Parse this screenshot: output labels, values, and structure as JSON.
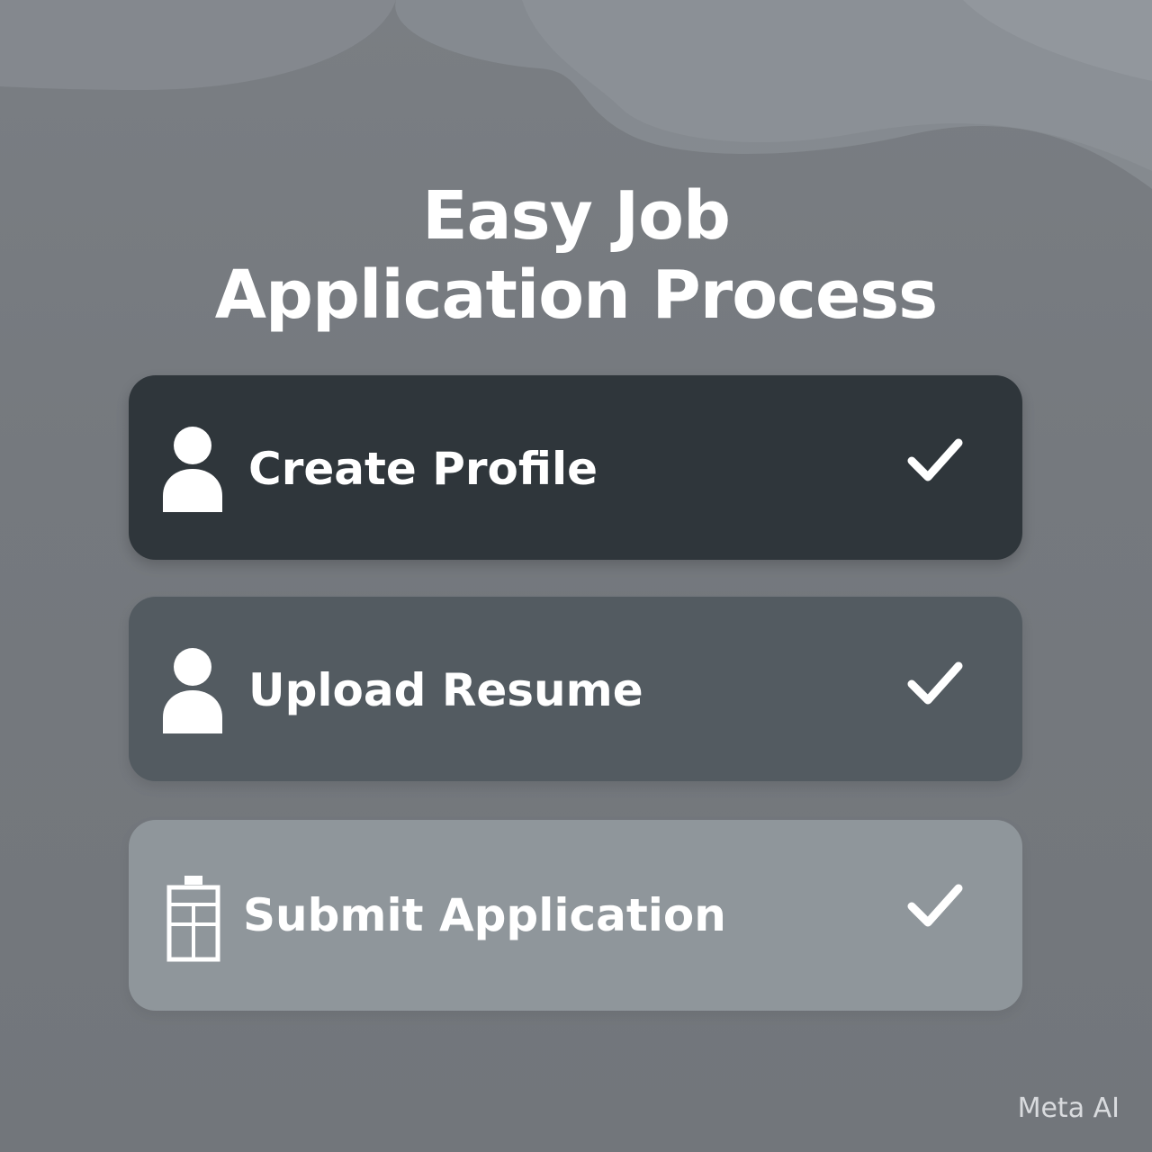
{
  "page": {
    "title_line1": "Easy Job",
    "title_line2": "Application Process",
    "background_color": "#75797e"
  },
  "steps": [
    {
      "label": "Create Profile",
      "icon": "user-icon",
      "status_icon": "checkmark-icon",
      "completed": true,
      "background": "#2f363b"
    },
    {
      "label": "Upload Resume",
      "icon": "user-icon",
      "status_icon": "checkmark-icon",
      "completed": true,
      "background": "#535b61"
    },
    {
      "label": "Submit Application",
      "icon": "clipboard-icon",
      "status_icon": "checkmark-icon",
      "completed": true,
      "background": "#8f969b"
    }
  ],
  "watermark": {
    "text": "Meta AI"
  }
}
